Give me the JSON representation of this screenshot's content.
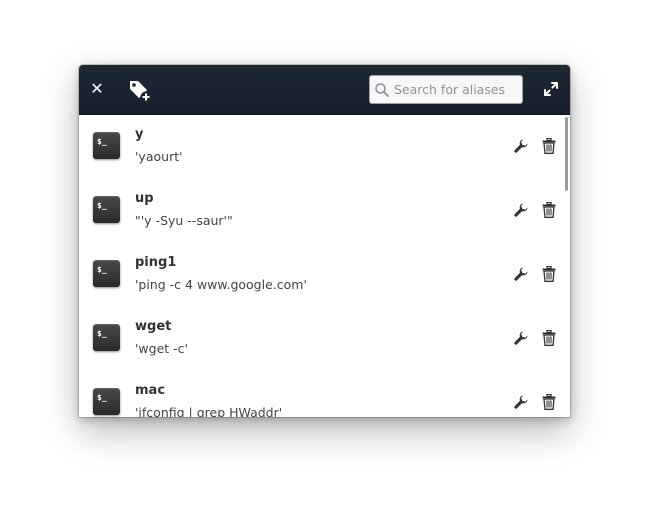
{
  "window": {
    "title": ""
  },
  "header": {
    "search": {
      "placeholder": "Search for aliases",
      "value": ""
    },
    "icons": {
      "close": "close-icon",
      "add_tag": "tag-add-icon",
      "search": "search-icon",
      "expand": "expand-icon"
    }
  },
  "aliases": [
    {
      "name": "y",
      "command": "'yaourt'"
    },
    {
      "name": "up",
      "command": "\"'y -Syu --saur'\""
    },
    {
      "name": "ping1",
      "command": "'ping -c 4 www.google.com'"
    },
    {
      "name": "wget",
      "command": "'wget -c'"
    },
    {
      "name": "mac",
      "command": "'ifconfig | grep HWaddr'"
    }
  ],
  "row_icons": {
    "terminal": "terminal-icon",
    "terminal_text": "$_",
    "edit": "wrench-icon",
    "delete": "trash-icon"
  },
  "colors": {
    "header_bg": "#1b2530",
    "icon_dark": "#333333",
    "terminal_bg": "#333333"
  }
}
